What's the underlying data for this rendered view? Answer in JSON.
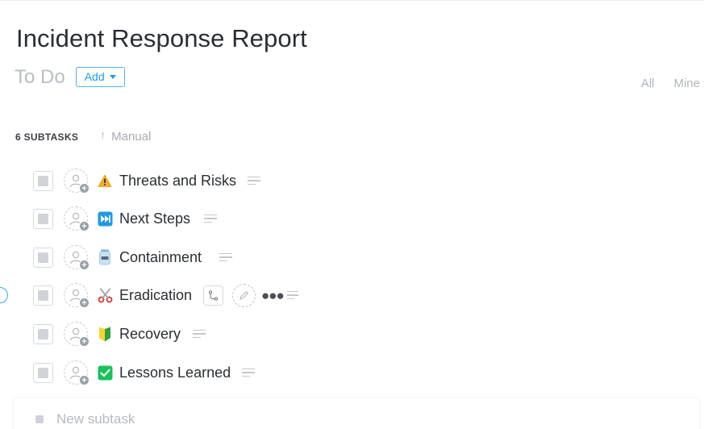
{
  "task": {
    "title": "Incident Response Report",
    "status": "To Do",
    "add_label": "Add"
  },
  "filters": {
    "all_label": "All",
    "mine_label": "Mine"
  },
  "subtasks": {
    "count_label": "6 SUBTASKS",
    "sort_label": "Manual",
    "items": [
      {
        "name": "Threats and Risks",
        "icon": "warning-icon"
      },
      {
        "name": "Next Steps",
        "icon": "fast-forward-icon"
      },
      {
        "name": "Containment",
        "icon": "jar-icon"
      },
      {
        "name": "Eradication",
        "icon": "scissors-icon"
      },
      {
        "name": "Recovery",
        "icon": "beginner-badge-icon"
      },
      {
        "name": "Lessons Learned",
        "icon": "check-mark-icon"
      }
    ],
    "new_placeholder": "New subtask"
  },
  "colors": {
    "accent": "#1c9de4",
    "text": "#2a2e34",
    "muted": "#b9bdc4"
  }
}
